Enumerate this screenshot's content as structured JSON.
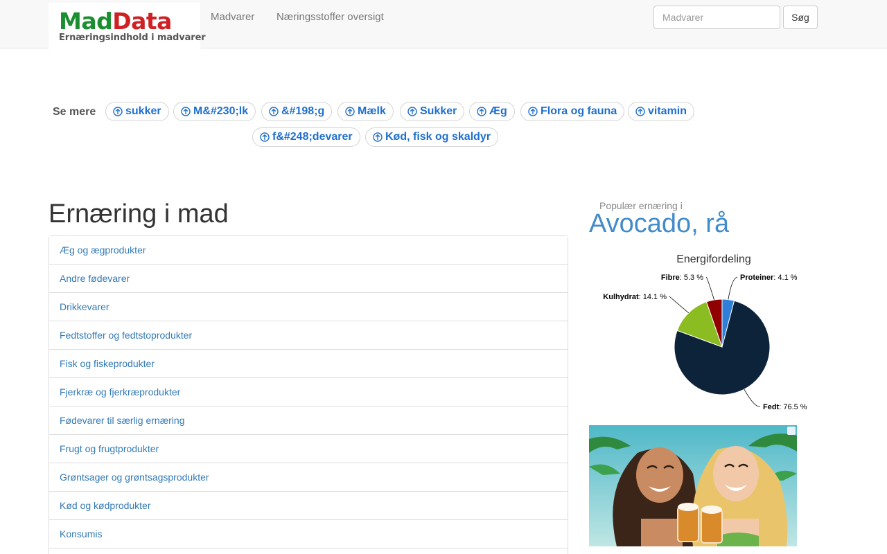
{
  "navbar": {
    "logo_mad": "Mad",
    "logo_data": "Data",
    "logo_sub": "Ernæringsindhold i madvarer",
    "links": [
      "Madvarer",
      "Næringsstoffer oversigt"
    ],
    "search_placeholder": "Madvarer",
    "search_button": "Søg"
  },
  "see_more": {
    "label": "Se mere",
    "tags": [
      "sukker",
      "M&#230;lk",
      "&#198;g",
      "Mælk",
      "Sukker",
      "Æg",
      "Flora og fauna",
      "vitamin",
      "f&#248;devarer",
      "Kød, fisk og skaldyr"
    ]
  },
  "main": {
    "title": "Ernæring i mad",
    "categories": [
      "Æg og ægprodukter",
      "Andre fødevarer",
      "Drikkevarer",
      "Fedtstoffer og fedtstoprodukter",
      "Fisk og fiskeprodukter",
      "Fjerkræ og fjerkræprodukter",
      "Fødevarer til særlig ernæring",
      "Frugt og frugtprodukter",
      "Grøntsager og grøntsagsprodukter",
      "Kød og kødprodukter",
      "Konsumis"
    ]
  },
  "sidebar": {
    "popular_label": "Populær ernæring i",
    "food_name": "Avocado, rå"
  },
  "chart_data": {
    "type": "pie",
    "title": "Energifordeling",
    "categories": [
      "Proteiner",
      "Fedt",
      "Kulhydrat",
      "Fibre"
    ],
    "values": [
      4.1,
      76.5,
      14.1,
      5.3
    ],
    "colors": [
      "#2f7ed8",
      "#0d233a",
      "#8bbc21",
      "#910000"
    ],
    "unit": "%"
  }
}
